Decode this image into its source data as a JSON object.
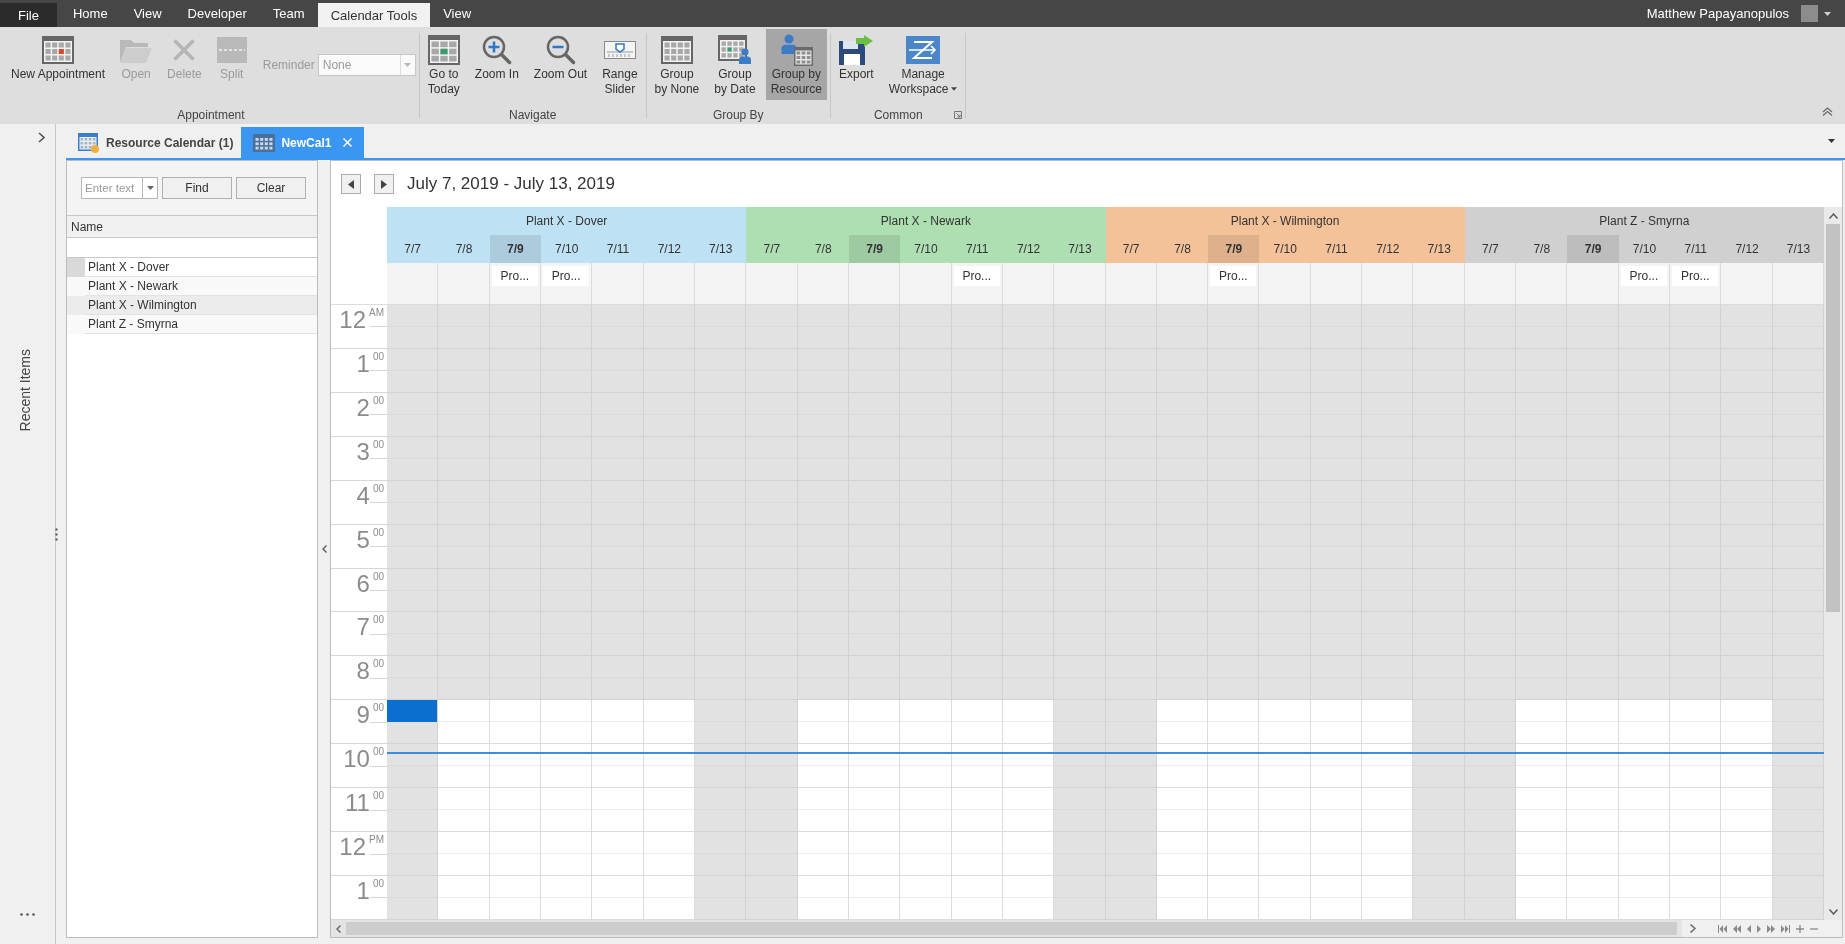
{
  "menu_bar": {
    "tabs": [
      {
        "label": "File",
        "kind": "file",
        "selected": false
      },
      {
        "label": "Home",
        "kind": "tab",
        "selected": false
      },
      {
        "label": "View",
        "kind": "tab",
        "selected": false
      },
      {
        "label": "Developer",
        "kind": "tab",
        "selected": false
      },
      {
        "label": "Team",
        "kind": "tab",
        "selected": false
      },
      {
        "label": "Calendar Tools",
        "kind": "tab",
        "selected": true
      },
      {
        "label": "View",
        "kind": "tab",
        "selected": false
      }
    ],
    "user": "Matthew Papayanopulos"
  },
  "ribbon": {
    "groups": [
      {
        "label": "Appointment",
        "items": [
          {
            "kind": "button",
            "label": "New Appointment",
            "disabled": false
          },
          {
            "kind": "button",
            "label": "Open",
            "disabled": true
          },
          {
            "kind": "button",
            "label": "Delete",
            "disabled": true
          },
          {
            "kind": "button",
            "label": "Split",
            "disabled": true
          },
          {
            "kind": "combo",
            "label": "Reminder",
            "value": "None",
            "disabled": true
          }
        ]
      },
      {
        "label": "Navigate",
        "items": [
          {
            "kind": "button",
            "label": "Go to\nToday",
            "disabled": false
          },
          {
            "kind": "button",
            "label": "Zoom In",
            "disabled": false
          },
          {
            "kind": "button",
            "label": "Zoom Out",
            "disabled": false
          },
          {
            "kind": "button",
            "label": "Range\nSlider",
            "disabled": false
          }
        ]
      },
      {
        "label": "Group By",
        "items": [
          {
            "kind": "toggle",
            "label": "Group\nby None",
            "selected": false
          },
          {
            "kind": "toggle",
            "label": "Group\nby Date",
            "selected": false
          },
          {
            "kind": "toggle",
            "label": "Group by\nResource",
            "selected": true
          }
        ]
      },
      {
        "label": "Common",
        "items": [
          {
            "kind": "button",
            "label": "Export",
            "disabled": false
          },
          {
            "kind": "menu_button",
            "label": "Manage\nWorkspace",
            "disabled": false
          }
        ]
      }
    ]
  },
  "sidebar": {
    "title": "Recent Items"
  },
  "document_tabs": [
    {
      "label": "Resource Calendar (1)",
      "selected": false
    },
    {
      "label": "NewCal1",
      "selected": true
    }
  ],
  "resource_list": {
    "search": {
      "placeholder": "Enter text"
    },
    "buttons": [
      "Find",
      "Clear"
    ],
    "column": "Name",
    "rows": [
      {
        "name": "Plant X - Dover",
        "focused": true,
        "highlighted": false
      },
      {
        "name": "Plant X - Newark",
        "focused": false,
        "highlighted": false
      },
      {
        "name": "Plant X - Wilmington",
        "focused": false,
        "highlighted": true
      },
      {
        "name": "Plant Z - Smyrna",
        "focused": false,
        "highlighted": false
      }
    ]
  },
  "calendar": {
    "range": "July 7, 2019 - July 13, 2019",
    "resources": [
      {
        "name": "Plant X - Dover",
        "color": "#bee1f4",
        "days": [
          {
            "date": "7/7",
            "today": false,
            "workday": false,
            "selected": true
          },
          {
            "date": "7/8",
            "today": false,
            "workday": true,
            "selected": false
          },
          {
            "date": "7/9",
            "today": true,
            "workday": true,
            "selected": false,
            "event": "Pro..."
          },
          {
            "date": "7/10",
            "today": false,
            "workday": true,
            "selected": false,
            "event": "Pro..."
          },
          {
            "date": "7/11",
            "today": false,
            "workday": true,
            "selected": false
          },
          {
            "date": "7/12",
            "today": false,
            "workday": true,
            "selected": false
          },
          {
            "date": "7/13",
            "today": false,
            "workday": false,
            "selected": false
          }
        ]
      },
      {
        "name": "Plant X - Newark",
        "color": "#aedfb2",
        "days": [
          {
            "date": "7/7",
            "today": false,
            "workday": false,
            "selected": false
          },
          {
            "date": "7/8",
            "today": false,
            "workday": true,
            "selected": false
          },
          {
            "date": "7/9",
            "today": true,
            "workday": true,
            "selected": false
          },
          {
            "date": "7/10",
            "today": false,
            "workday": true,
            "selected": false
          },
          {
            "date": "7/11",
            "today": false,
            "workday": true,
            "selected": false,
            "event": "Pro..."
          },
          {
            "date": "7/12",
            "today": false,
            "workday": true,
            "selected": false
          },
          {
            "date": "7/13",
            "today": false,
            "workday": false,
            "selected": false
          }
        ]
      },
      {
        "name": "Plant X - Wilmington",
        "color": "#f4c299",
        "days": [
          {
            "date": "7/7",
            "today": false,
            "workday": false,
            "selected": false
          },
          {
            "date": "7/8",
            "today": false,
            "workday": true,
            "selected": false
          },
          {
            "date": "7/9",
            "today": true,
            "workday": true,
            "selected": false,
            "event": "Pro..."
          },
          {
            "date": "7/10",
            "today": false,
            "workday": true,
            "selected": false
          },
          {
            "date": "7/11",
            "today": false,
            "workday": true,
            "selected": false
          },
          {
            "date": "7/12",
            "today": false,
            "workday": true,
            "selected": false
          },
          {
            "date": "7/13",
            "today": false,
            "workday": false,
            "selected": false
          }
        ]
      },
      {
        "name": "Plant Z - Smyrna",
        "color": "#d0d0d0",
        "days": [
          {
            "date": "7/7",
            "today": false,
            "workday": false,
            "selected": false
          },
          {
            "date": "7/8",
            "today": false,
            "workday": true,
            "selected": false
          },
          {
            "date": "7/9",
            "today": true,
            "workday": true,
            "selected": false
          },
          {
            "date": "7/10",
            "today": false,
            "workday": true,
            "selected": false,
            "event": "Pro..."
          },
          {
            "date": "7/11",
            "today": false,
            "workday": true,
            "selected": false,
            "event": "Pro..."
          },
          {
            "date": "7/12",
            "today": false,
            "workday": true,
            "selected": false
          },
          {
            "date": "7/13",
            "today": false,
            "workday": false,
            "selected": false
          }
        ]
      }
    ],
    "hours": [
      {
        "label": "12$^{AM}$",
        "work": false,
        "selected": false,
        "current": false
      },
      {
        "label": "1$^{00}$",
        "work": false,
        "selected": false,
        "current": false
      },
      {
        "label": "2$^{00}$",
        "work": false,
        "selected": false,
        "current": false
      },
      {
        "label": "3$^{00}$",
        "work": false,
        "selected": false,
        "current": false
      },
      {
        "label": "4$^{00}$",
        "work": false,
        "selected": false,
        "current": false
      },
      {
        "label": "5$^{00}$",
        "work": false,
        "selected": false,
        "current": false
      },
      {
        "label": "6$^{00}$",
        "work": false,
        "selected": false,
        "current": false
      },
      {
        "label": "7$^{00}$",
        "work": false,
        "selected": false,
        "current": false
      },
      {
        "label": "8$^{00}$",
        "work": false,
        "selected": false,
        "current": false
      },
      {
        "label": "9$^{00}$",
        "work": true,
        "selected": true,
        "current": false
      },
      {
        "label": "10$^{00}$",
        "work": true,
        "selected": false,
        "current": true
      },
      {
        "label": "11$^{00}$",
        "work": true,
        "selected": false,
        "current": false
      },
      {
        "label": "12$^{PM}$",
        "work": true,
        "selected": false,
        "current": false
      },
      {
        "label": "1$^{00}$",
        "work": true,
        "selected": false,
        "current": false
      }
    ]
  }
}
